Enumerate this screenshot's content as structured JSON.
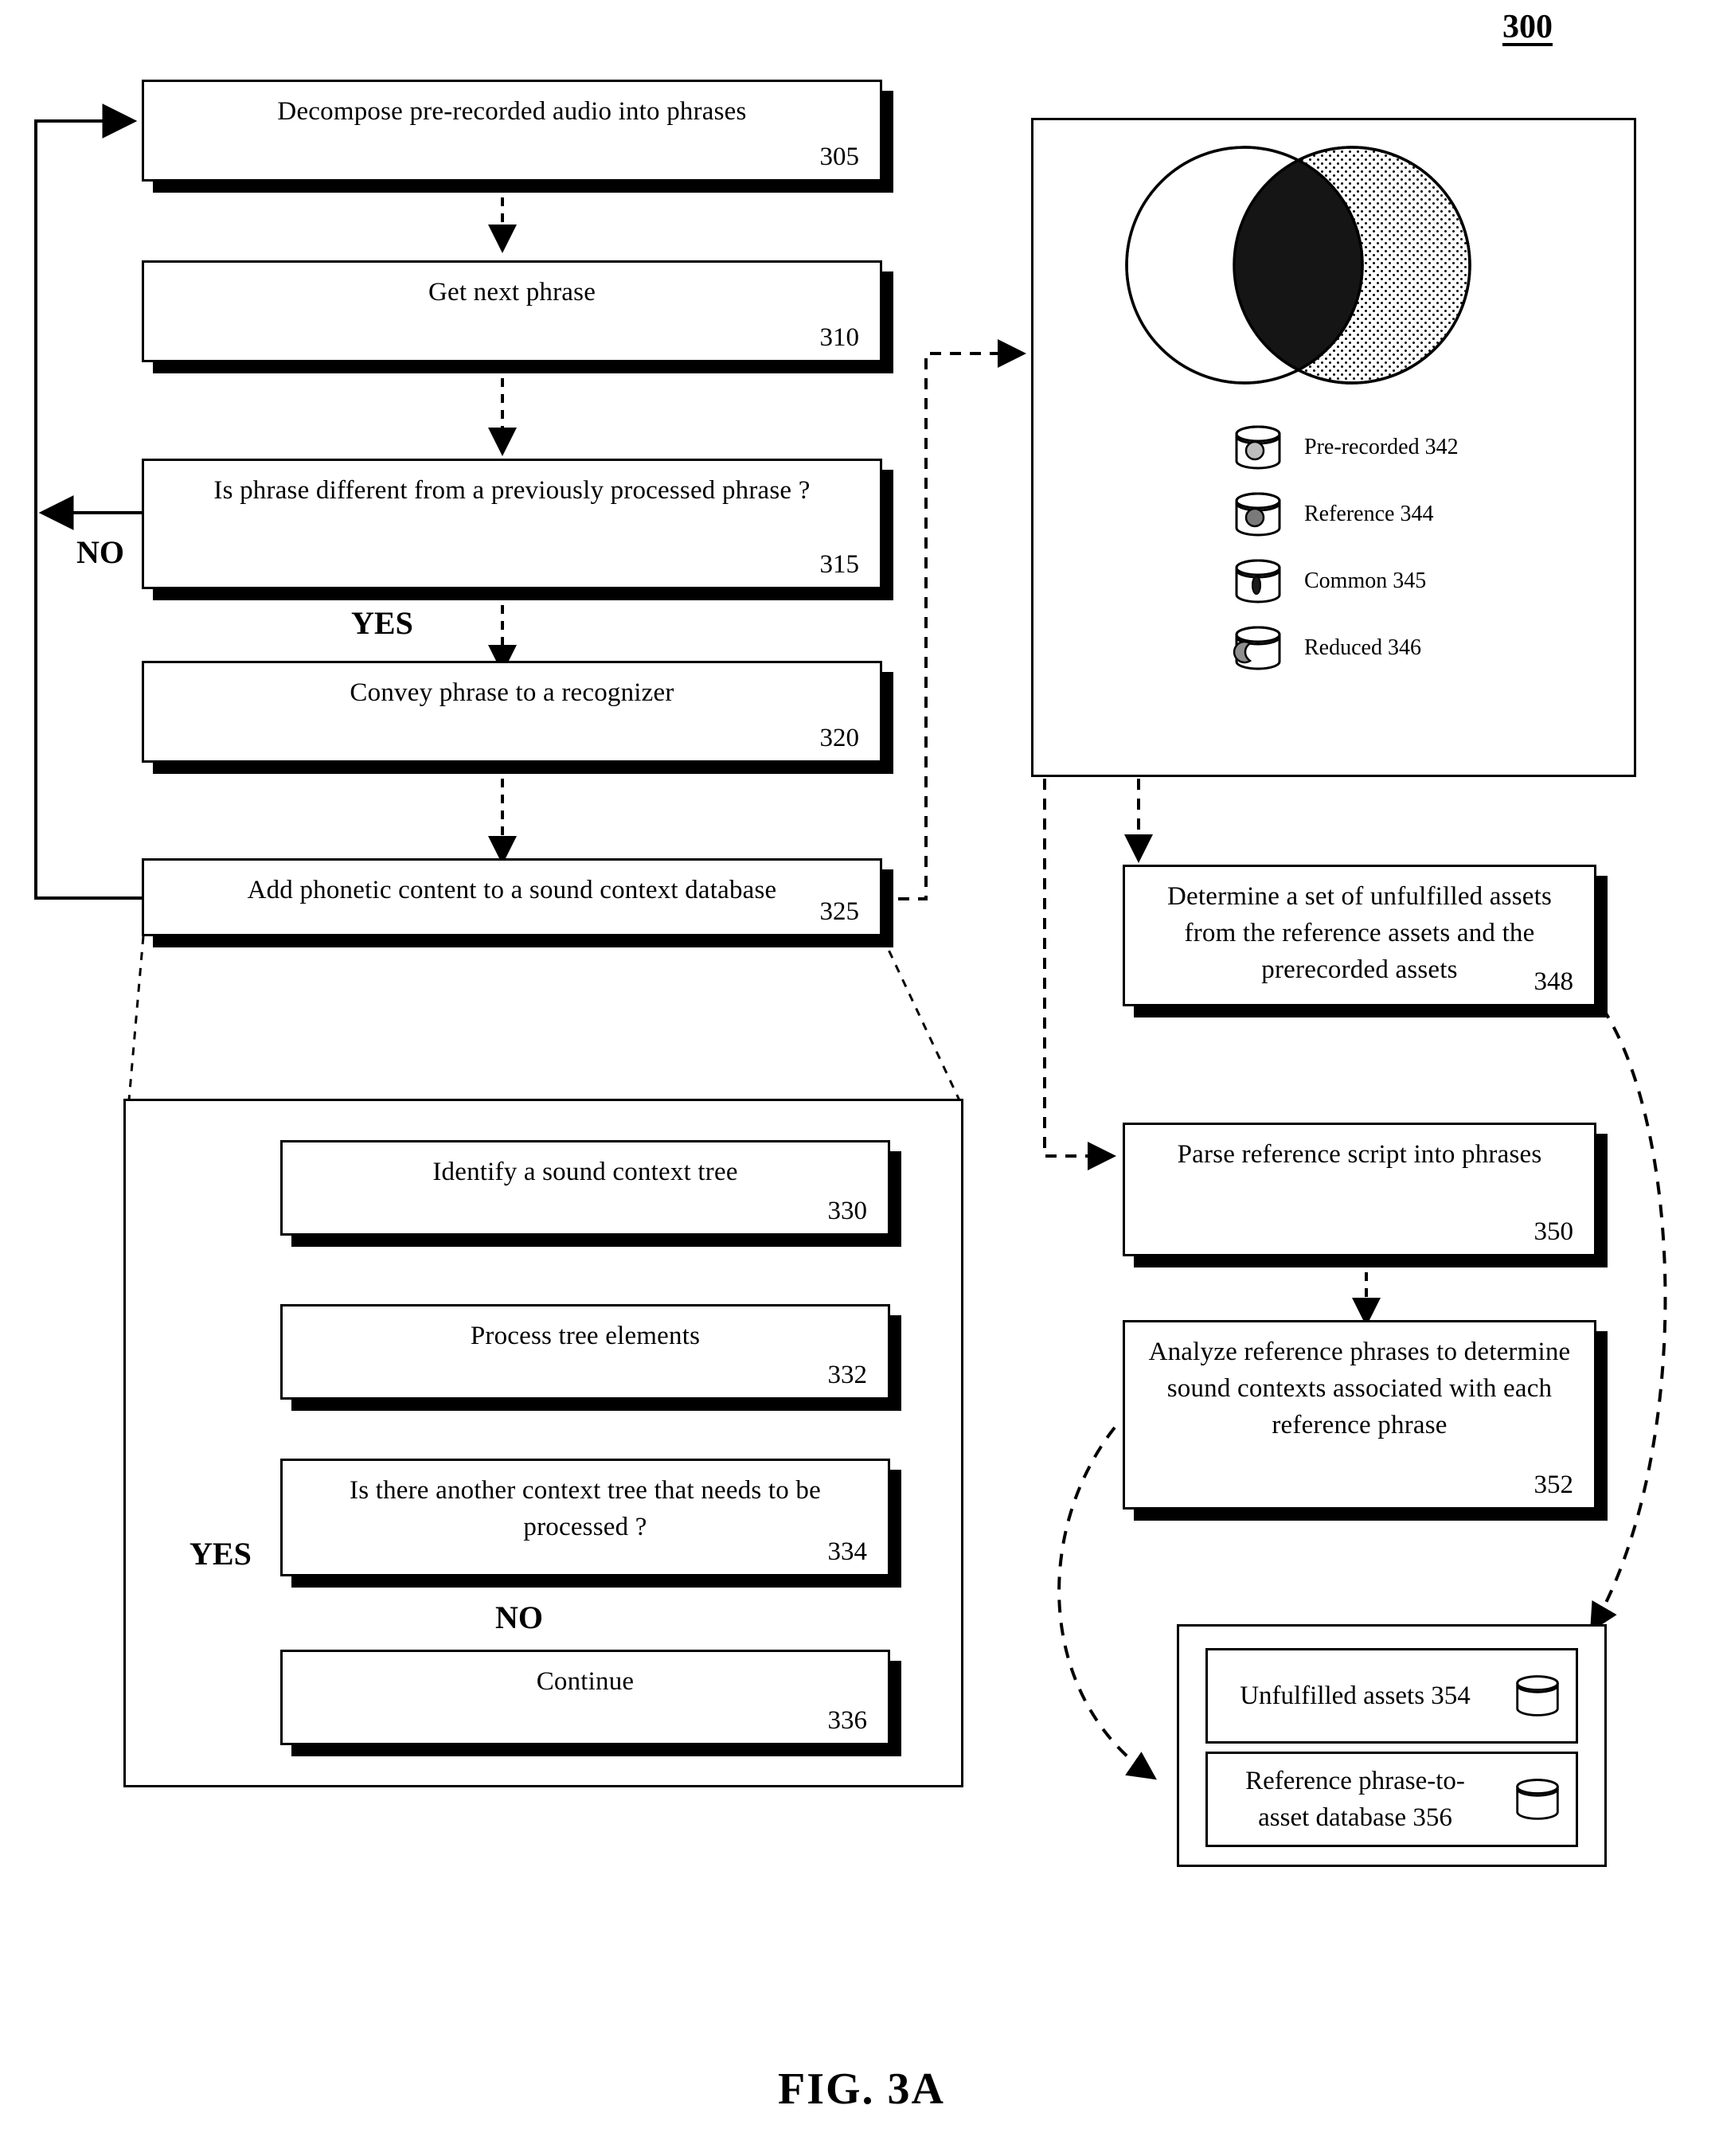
{
  "figure": {
    "reference_numeral": "300",
    "caption": "FIG. 3A"
  },
  "flow_boxes": [
    {
      "id": "305",
      "text": "Decompose pre-recorded audio into phrases",
      "num": "305"
    },
    {
      "id": "310",
      "text": "Get next phrase",
      "num": "310"
    },
    {
      "id": "315",
      "text": "Is phrase different from a previously processed phrase ?",
      "num": "315"
    },
    {
      "id": "320",
      "text": "Convey phrase to a recognizer",
      "num": "320"
    },
    {
      "id": "325",
      "text": "Add phonetic content to a sound context database",
      "num": "325"
    },
    {
      "id": "330",
      "text": "Identify a sound context tree",
      "num": "330"
    },
    {
      "id": "332",
      "text": "Process tree elements",
      "num": "332"
    },
    {
      "id": "334",
      "text": "Is there another context tree that needs to be processed ?",
      "num": "334"
    },
    {
      "id": "336",
      "text": "Continue",
      "num": "336"
    },
    {
      "id": "348",
      "text": "Determine a set of unfulfilled assets from the reference assets and the prerecorded assets",
      "num": "348"
    },
    {
      "id": "350",
      "text": "Parse reference script into phrases",
      "num": "350"
    },
    {
      "id": "352",
      "text": "Analyze reference phrases to determine sound contexts associated with each reference phrase",
      "num": "352"
    }
  ],
  "branch_labels": {
    "no_315": "NO",
    "yes_315": "YES",
    "yes_334": "YES",
    "no_334": "NO"
  },
  "venn": {
    "left_circle_fill": "#ffffff",
    "right_circle_fill": "#f2f2f2",
    "intersection_fill": "#1a1a1a",
    "stroke": "#000000"
  },
  "legend": [
    {
      "label": "Pre-recorded 342",
      "icon": "database-cylinder-icon",
      "marker": "circle-hatched"
    },
    {
      "label": "Reference 344",
      "icon": "database-cylinder-icon",
      "marker": "circle-crosshatched"
    },
    {
      "label": "Common 345",
      "icon": "database-cylinder-icon",
      "marker": "lens-dark"
    },
    {
      "label": "Reduced 346",
      "icon": "database-cylinder-icon",
      "marker": "crescent-hatched"
    }
  ],
  "asset_boxes": [
    {
      "text": "Unfulfilled assets 354",
      "icon": "database-cylinder-icon"
    },
    {
      "text": "Reference phrase-to-asset database 356",
      "icon": "database-cylinder-icon"
    }
  ]
}
